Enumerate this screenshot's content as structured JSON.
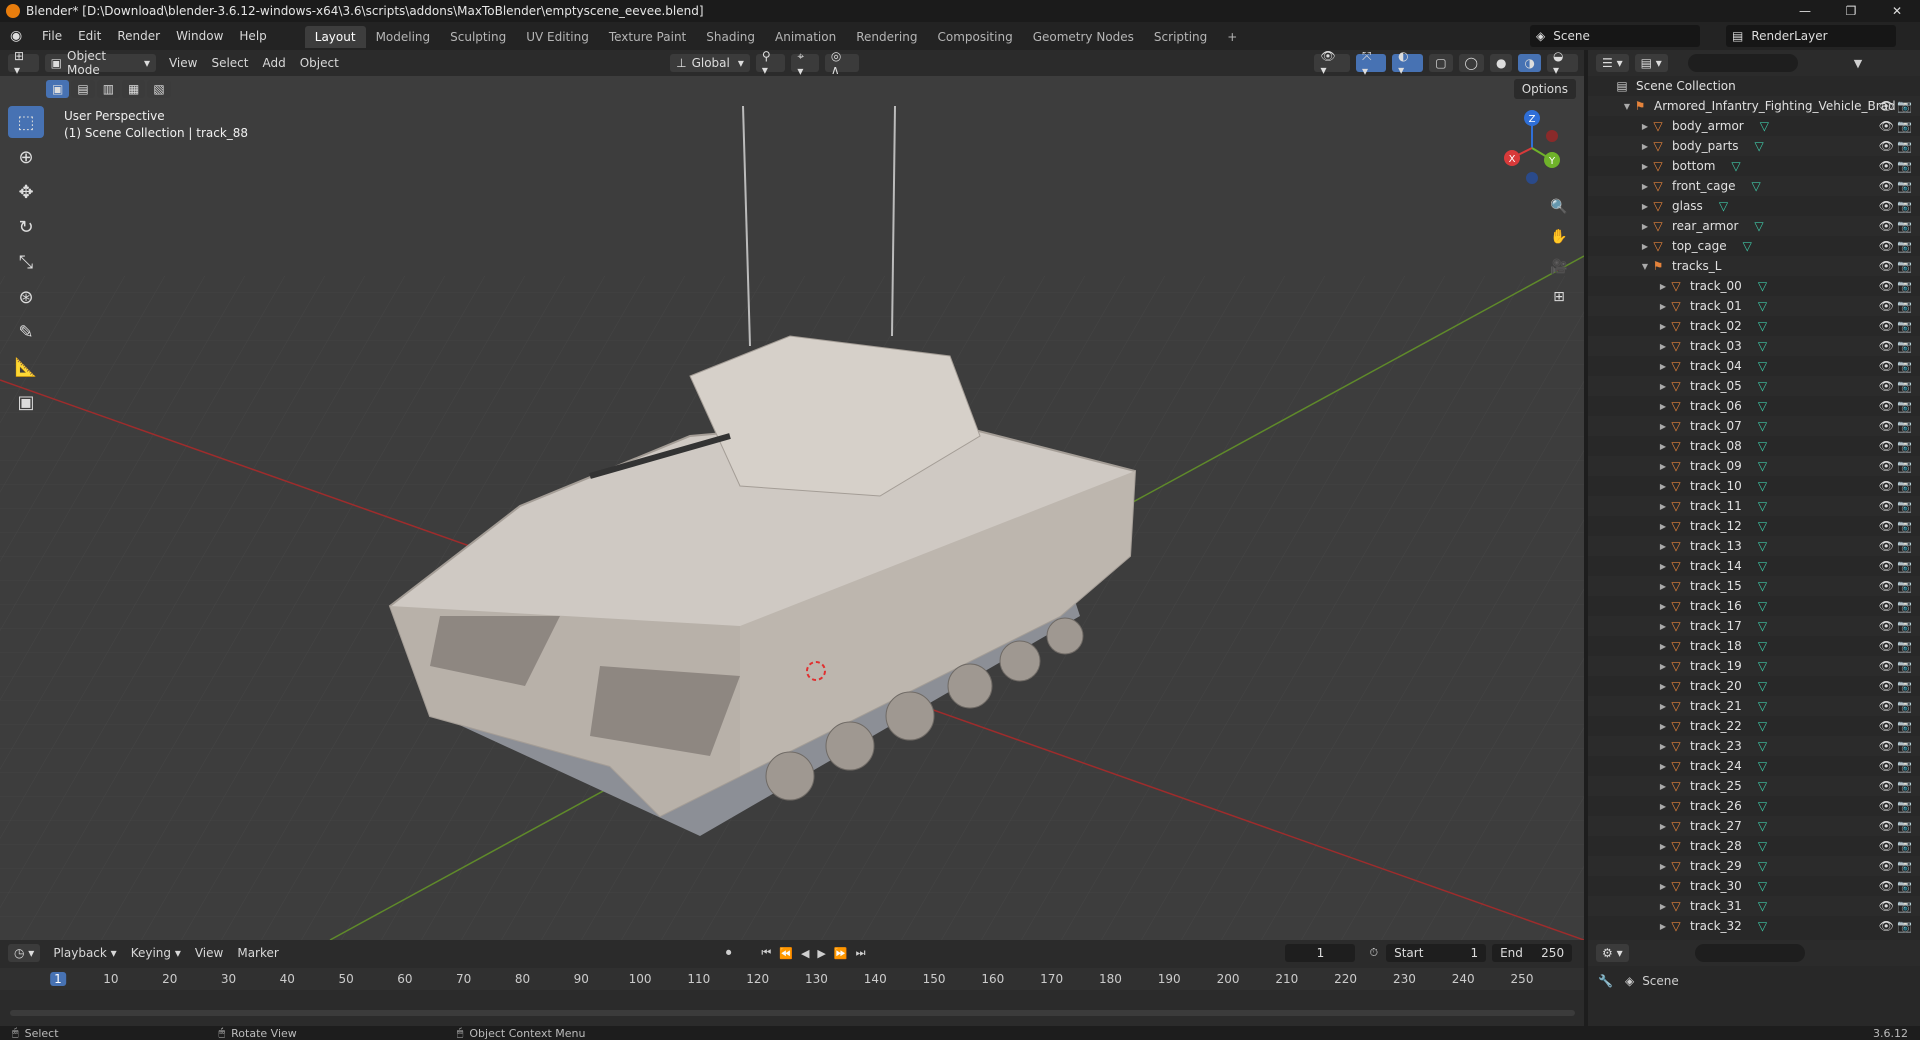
{
  "window": {
    "title": "Blender* [D:\\Download\\blender-3.6.12-windows-x64\\3.6\\scripts\\addons\\MaxToBlender\\emptyscene_eevee.blend]",
    "controls": [
      "—",
      "❐",
      "✕"
    ]
  },
  "menubar": {
    "items": [
      "File",
      "Edit",
      "Render",
      "Window",
      "Help"
    ],
    "workspaces": [
      "Layout",
      "Modeling",
      "Sculpting",
      "UV Editing",
      "Texture Paint",
      "Shading",
      "Animation",
      "Rendering",
      "Compositing",
      "Geometry Nodes",
      "Scripting"
    ],
    "active_workspace": "Layout",
    "add_tab": "+",
    "scene_name": "Scene",
    "view_layer": "RenderLayer"
  },
  "viewport_header": {
    "mode": "Object Mode",
    "menus": [
      "View",
      "Select",
      "Add",
      "Object"
    ],
    "orientation": "Global",
    "options_label": "Options"
  },
  "viewport": {
    "perspective_label": "User Perspective",
    "context_label": "(1) Scene Collection | track_88",
    "gizmo_axes": [
      "X",
      "Y",
      "Z"
    ],
    "colors": {
      "x_axis": "#9e2c2c",
      "y_axis": "#5f8a2a",
      "accent": "#4772b3"
    },
    "tools": [
      "select-box",
      "cursor",
      "move",
      "rotate",
      "scale",
      "transform",
      "annotate",
      "measure",
      "add-cube"
    ]
  },
  "outliner": {
    "search_placeholder": "",
    "root": "Scene Collection",
    "collection": "Armored_Infantry_Fighting_Vehicle_Brad",
    "objects": [
      "body_armor",
      "body_parts",
      "bottom",
      "front_cage",
      "glass",
      "rear_armor",
      "top_cage"
    ],
    "group": "tracks_L",
    "tracks": [
      "track_00",
      "track_01",
      "track_02",
      "track_03",
      "track_04",
      "track_05",
      "track_06",
      "track_07",
      "track_08",
      "track_09",
      "track_10",
      "track_11",
      "track_12",
      "track_13",
      "track_14",
      "track_15",
      "track_16",
      "track_17",
      "track_18",
      "track_19",
      "track_20",
      "track_21",
      "track_22",
      "track_23",
      "track_24",
      "track_25",
      "track_26",
      "track_27",
      "track_28",
      "track_29",
      "track_30",
      "track_31",
      "track_32"
    ]
  },
  "timeline": {
    "menus": [
      "Playback",
      "Keying",
      "View",
      "Marker"
    ],
    "current_frame": "1",
    "start_label": "Start",
    "start": "1",
    "end_label": "End",
    "end": "250",
    "ticks": [
      "1",
      "10",
      "20",
      "30",
      "40",
      "50",
      "60",
      "70",
      "80",
      "90",
      "100",
      "110",
      "120",
      "130",
      "140",
      "150",
      "160",
      "170",
      "180",
      "190",
      "200",
      "210",
      "220",
      "230",
      "240",
      "250"
    ]
  },
  "properties": {
    "scene_label": "Scene"
  },
  "statusbar": {
    "select": "Select",
    "rotate": "Rotate View",
    "context_menu": "Object Context Menu",
    "version": "3.6.12"
  }
}
